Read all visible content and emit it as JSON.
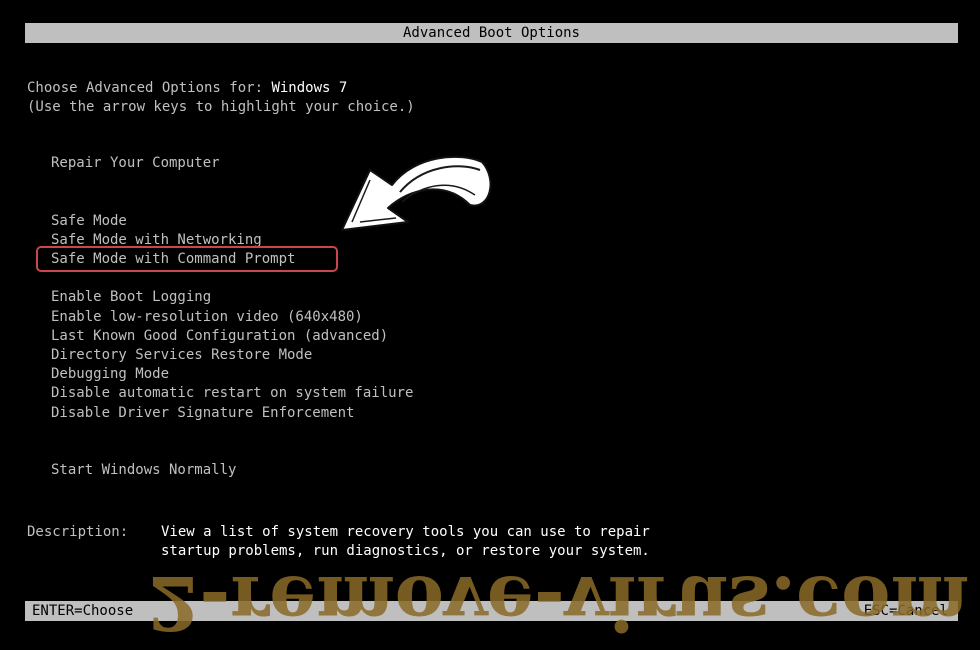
{
  "header": {
    "title": "Advanced Boot Options"
  },
  "intro": {
    "choose_label": "Choose Advanced Options for: ",
    "os_name": "Windows 7",
    "hint": "(Use the arrow keys to highlight your choice.)"
  },
  "options": {
    "repair": "Repair Your Computer",
    "safe_mode": "Safe Mode",
    "safe_mode_networking": "Safe Mode with Networking",
    "safe_mode_command_prompt": "Safe Mode with Command Prompt",
    "boot_logging": "Enable Boot Logging",
    "low_res_video": "Enable low-resolution video (640x480)",
    "last_known_good": "Last Known Good Configuration (advanced)",
    "directory_services": "Directory Services Restore Mode",
    "debugging": "Debugging Mode",
    "disable_auto_restart": "Disable automatic restart on system failure",
    "disable_driver_sig": "Disable Driver Signature Enforcement",
    "start_normally": "Start Windows Normally"
  },
  "description": {
    "label": "Description:",
    "line1": "View a list of system recovery tools you can use to repair",
    "line2": "startup problems, run diagnostics, or restore your system."
  },
  "footer": {
    "enter": "ENTER=Choose",
    "esc": "ESC=Cancel"
  },
  "watermark": {
    "text": "2-remove-virus.com"
  },
  "colors": {
    "background": "#000000",
    "text": "#c0c0c0",
    "bar": "#bfbfbf",
    "highlight_border": "#c9474b",
    "watermark": "#8a6a27"
  },
  "icons": {
    "annotation_arrow": "curved-arrow-icon"
  }
}
